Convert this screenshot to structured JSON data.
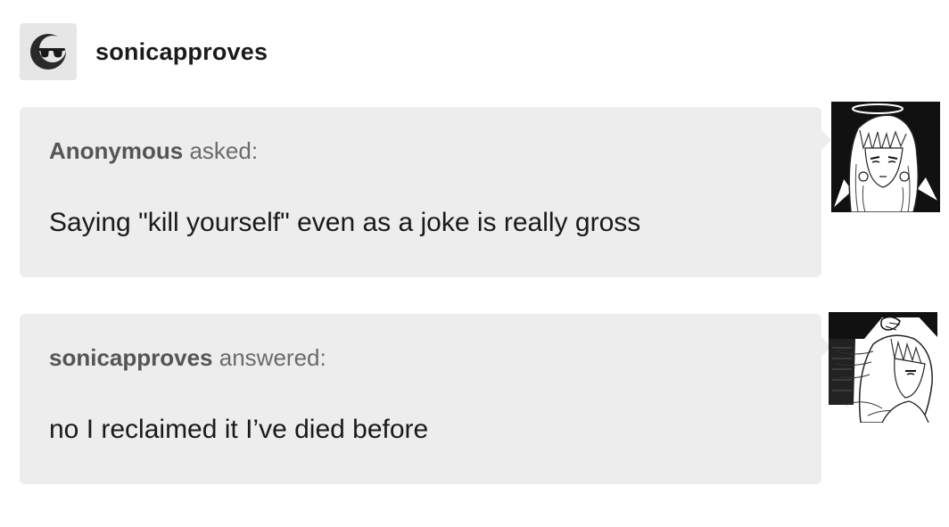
{
  "post": {
    "blog_name": "sonicapproves",
    "avatar_icon": "sunglasses-moon-icon"
  },
  "ask": {
    "asker": "Anonymous",
    "verb": "asked:",
    "message": "Saying \"kill yourself\" even as a joke is really gross",
    "avatar_icon": "manga-angel-girl-avatar"
  },
  "answer": {
    "answerer": "sonicapproves",
    "verb": "answered:",
    "message": "no I reclaimed it I’ve died before",
    "avatar_icon": "manga-girl-profile-avatar"
  },
  "colors": {
    "bubble": "#ededed",
    "avatar_bg": "#e6e6e6",
    "text": "#1a1a1a",
    "muted": "#6b6b6b"
  }
}
